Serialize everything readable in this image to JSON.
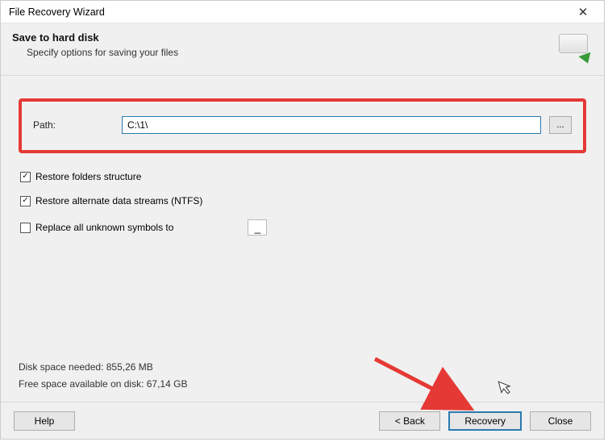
{
  "titlebar": {
    "title": "File Recovery Wizard"
  },
  "header": {
    "heading": "Save to hard disk",
    "subheading": "Specify options for saving your files"
  },
  "path": {
    "label": "Path:",
    "value": "C:\\1\\",
    "browse_label": "..."
  },
  "options": {
    "restore_folders": {
      "label": "Restore folders structure",
      "checked": true
    },
    "restore_ads": {
      "label": "Restore alternate data streams (NTFS)",
      "checked": true
    },
    "replace_symbols": {
      "label": "Replace all unknown symbols to",
      "checked": false,
      "value": "_"
    }
  },
  "disk": {
    "needed": "Disk space needed: 855,26 MB",
    "free": "Free space available on disk: 67,14 GB"
  },
  "footer": {
    "help": "Help",
    "back": "< Back",
    "recovery": "Recovery",
    "close": "Close"
  }
}
